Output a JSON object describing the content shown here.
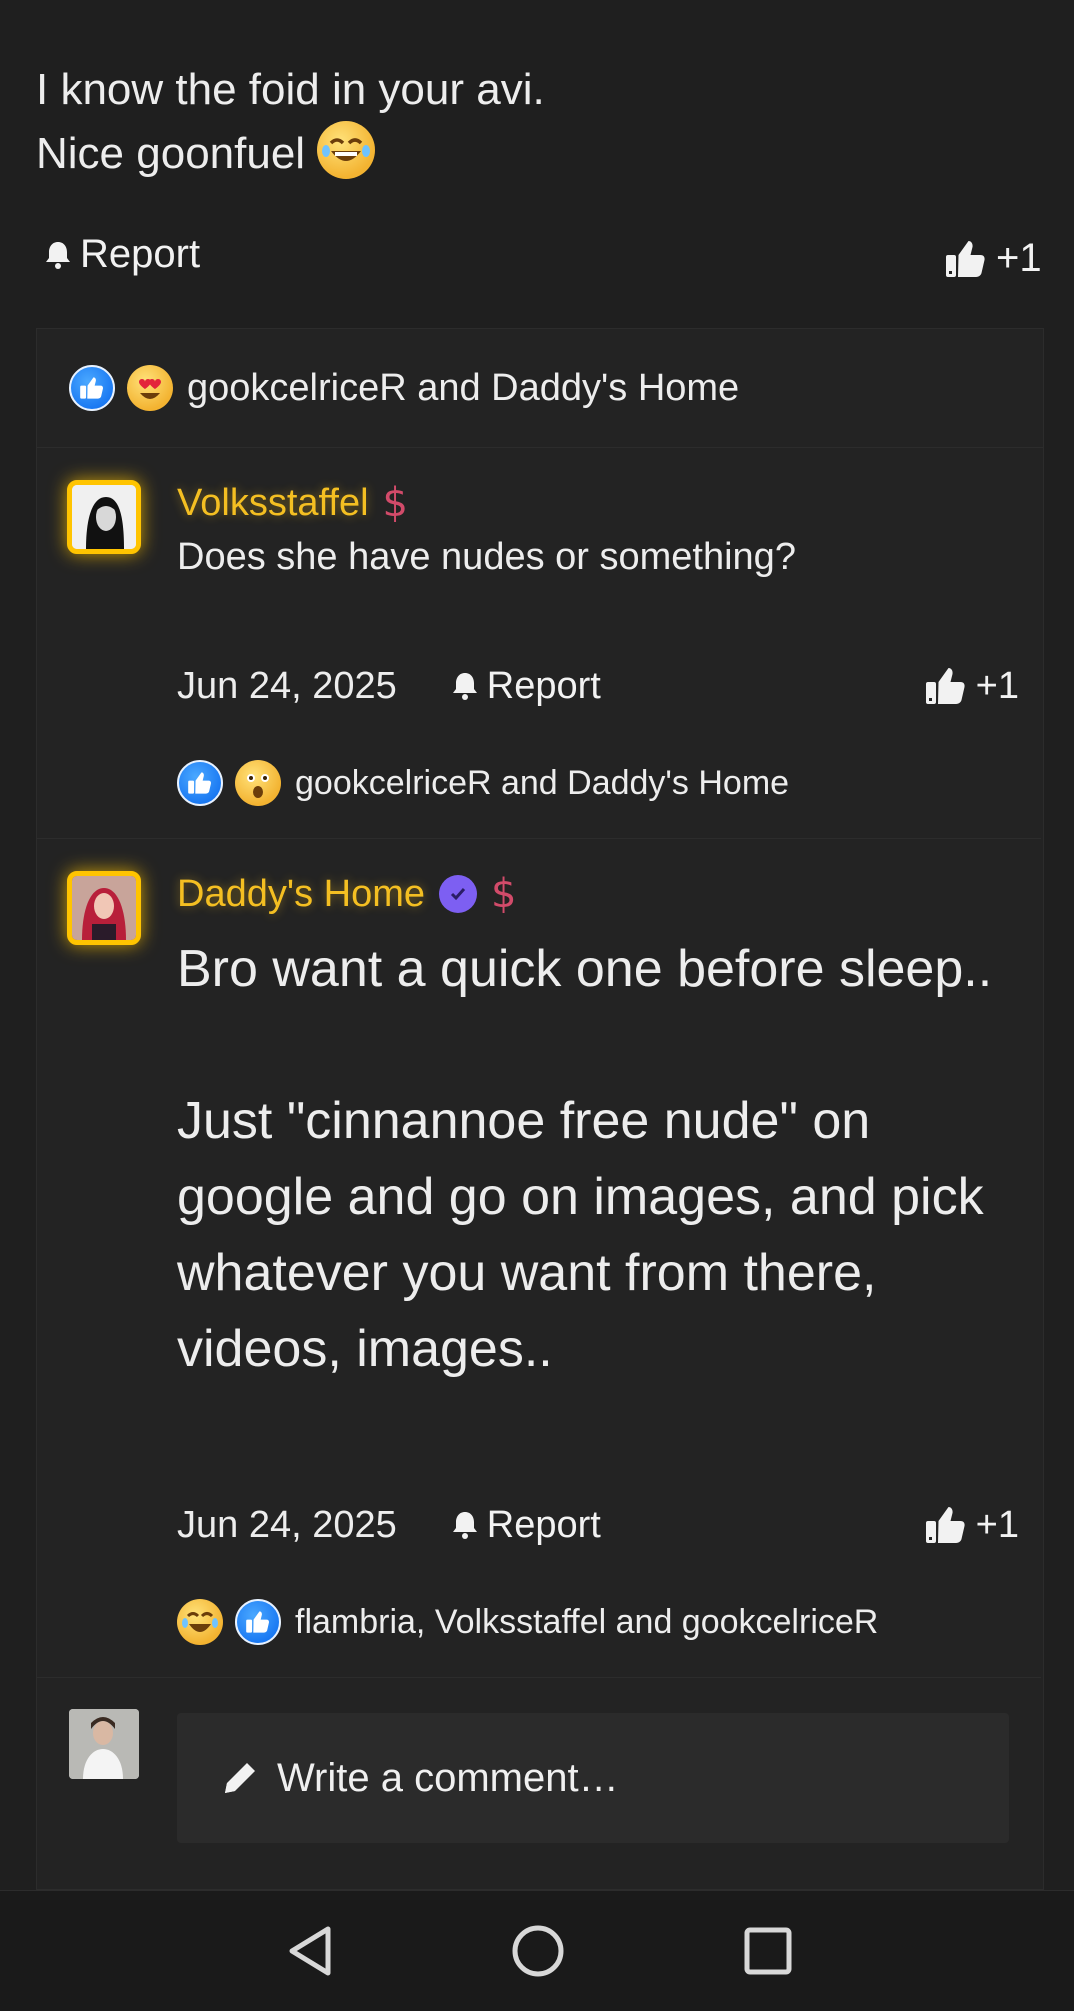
{
  "post": {
    "text_line1": "I know the foid in your avi.",
    "text_line2": "Nice goonfuel",
    "report_label": "Report",
    "like_count": "+1"
  },
  "thread": {
    "reactions_names": "gookcelriceR and Daddy's Home",
    "comments": [
      {
        "author": "Volksstaffel",
        "text": "Does she have nudes or something?",
        "date": "Jun 24, 2025",
        "report_label": "Report",
        "like_count": "+1",
        "reactions_names": "gookcelriceR and Daddy's Home"
      },
      {
        "author": "Daddy's Home",
        "text_p1": "Bro want a quick one before sleep..",
        "text_p2": "Just \"cinnannoe free nude\" on google and go on images, and pick whatever you want from there, videos, images..",
        "date": "Jun 24, 2025",
        "report_label": "Report",
        "like_count": "+1",
        "reactions_names": "flambria, Volksstaffel and gookcelriceR"
      }
    ]
  },
  "compose": {
    "placeholder": "Write a comment…"
  },
  "colors": {
    "accent": "#f4bf22",
    "like_blue": "#1877f2",
    "verified": "#7d5ff2",
    "background": "#1f1f1f"
  },
  "icons": [
    "bell-icon",
    "thumbs-up-icon",
    "pencil-icon",
    "back-icon",
    "home-icon",
    "recents-icon"
  ]
}
